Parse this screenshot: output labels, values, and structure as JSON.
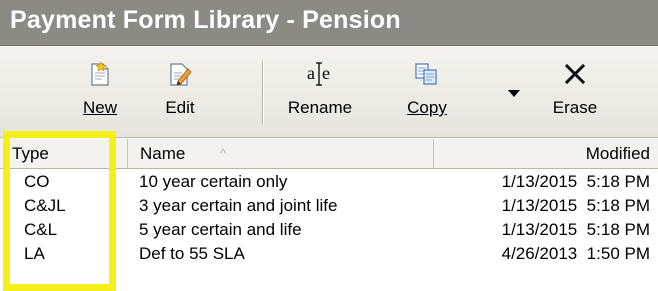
{
  "window": {
    "title": "Payment Form Library - Pension"
  },
  "toolbar": {
    "buttons": [
      {
        "id": "new",
        "label": "New",
        "icon": "new-document-icon"
      },
      {
        "id": "edit",
        "label": "Edit",
        "icon": "edit-pencil-icon"
      },
      {
        "id": "rename",
        "label": "Rename",
        "icon": "rename-text-icon"
      },
      {
        "id": "copy",
        "label": "Copy",
        "icon": "copy-icon"
      },
      {
        "id": "erase",
        "label": "Erase",
        "icon": "erase-x-icon"
      }
    ],
    "copy_dropdown_icon": "caret-down-icon"
  },
  "table": {
    "columns": {
      "type": "Type",
      "name": "Name",
      "modified": "Modified"
    },
    "sort_indicator": "sort-ascending-icon",
    "rows": [
      {
        "type": "CO",
        "name": "10 year certain only",
        "modified": "1/13/2015  5:18 PM"
      },
      {
        "type": "C&JL",
        "name": "3 year certain and joint life",
        "modified": "1/13/2015  5:18 PM"
      },
      {
        "type": "C&L",
        "name": "5 year certain and life",
        "modified": "1/13/2015  5:18 PM"
      },
      {
        "type": "LA",
        "name": "Def to 55 SLA",
        "modified": "4/26/2013  1:50 PM"
      }
    ]
  },
  "colors": {
    "title_bar": "#8c8a84",
    "highlight": "#f5ef1a"
  }
}
